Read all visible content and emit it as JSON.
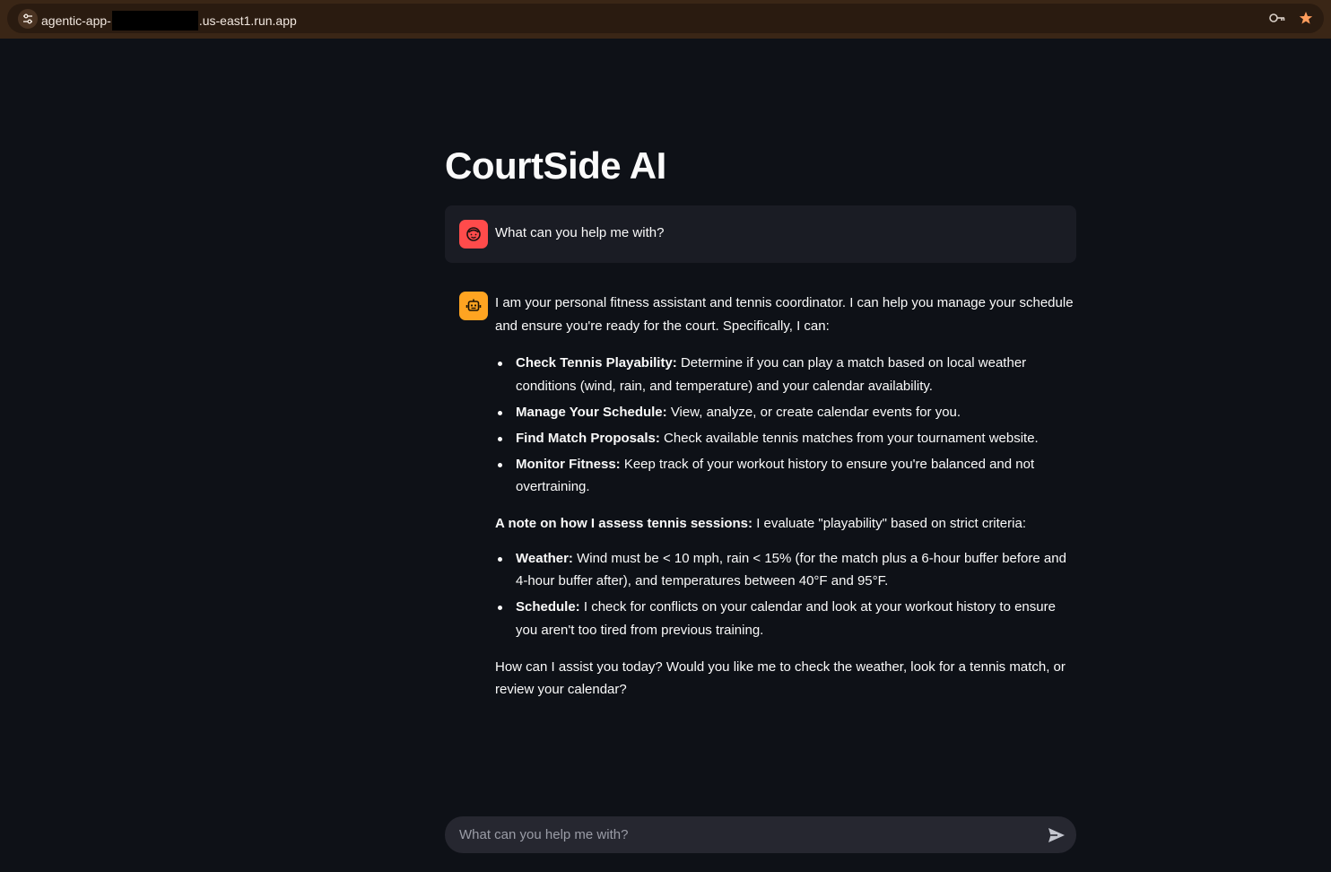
{
  "browser": {
    "url_prefix": "agentic-app-",
    "url_suffix": ".us-east1.run.app"
  },
  "app": {
    "title": "CourtSide AI"
  },
  "user_message": {
    "text": "What can you help me with?",
    "avatar_icon": "face-icon",
    "avatar_color": "#ff4b4b"
  },
  "assistant_message": {
    "avatar_icon": "robot-icon",
    "avatar_color": "#ffa421",
    "intro": "I am your personal fitness assistant and tennis coordinator. I can help you manage your schedule and ensure you're ready for the court. Specifically, I can:",
    "capabilities": [
      {
        "title": "Check Tennis Playability:",
        "text": " Determine if you can play a match based on local weather conditions (wind, rain, and temperature) and your calendar availability."
      },
      {
        "title": "Manage Your Schedule:",
        "text": " View, analyze, or create calendar events for you."
      },
      {
        "title": "Find Match Proposals:",
        "text": " Check available tennis matches from your tournament website."
      },
      {
        "title": "Monitor Fitness:",
        "text": " Keep track of your workout history to ensure you're balanced and not overtraining."
      }
    ],
    "note_title": "A note on how I assess tennis sessions:",
    "note_text": " I evaluate \"playability\" based on strict criteria:",
    "criteria": [
      {
        "title": "Weather:",
        "text": " Wind must be < 10 mph, rain < 15% (for the match plus a 6-hour buffer before and 4-hour buffer after), and temperatures between 40°F and 95°F."
      },
      {
        "title": "Schedule:",
        "text": " I check for conflicts on your calendar and look at your workout history to ensure you aren't too tired from previous training."
      }
    ],
    "closing": "How can I assist you today? Would you like me to check the weather, look for a tennis match, or review your calendar?"
  },
  "chat_input": {
    "placeholder": "What can you help me with?",
    "send_icon": "send-icon"
  }
}
